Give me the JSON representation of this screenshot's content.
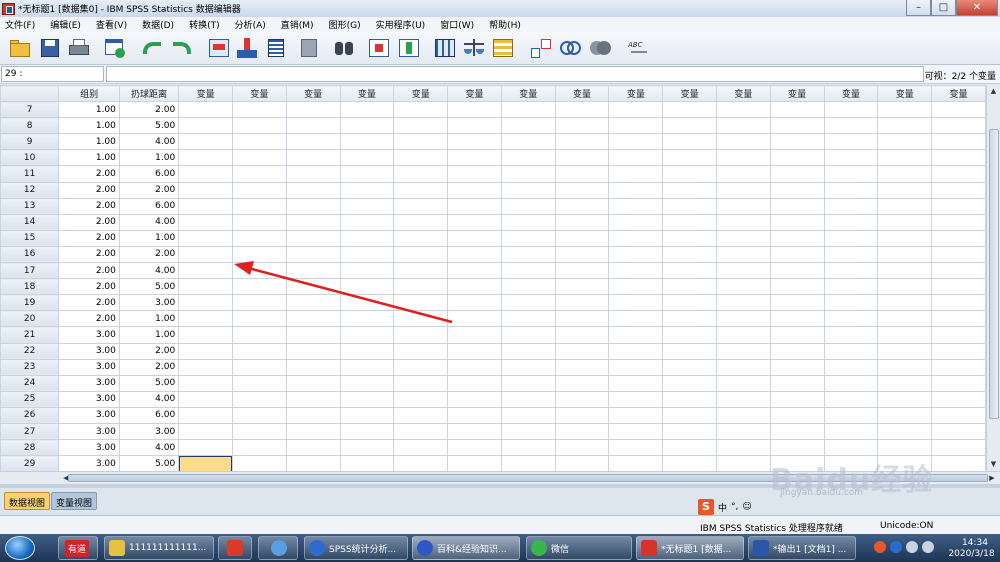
{
  "window": {
    "title": "*无标题1 [数据集0] - IBM SPSS Statistics 数据编辑器",
    "minimize": "–",
    "maximize": "□",
    "close": "✕"
  },
  "menu": [
    "文件(F)",
    "编辑(E)",
    "查看(V)",
    "数据(D)",
    "转换(T)",
    "分析(A)",
    "直销(M)",
    "图形(G)",
    "实用程序(U)",
    "窗口(W)",
    "帮助(H)"
  ],
  "toolbar_icons": [
    "open-icon",
    "save-icon",
    "print-icon",
    "dialog-recall-icon",
    "undo-icon",
    "redo-icon",
    "goto-case-icon",
    "goto-variable-icon",
    "variables-icon",
    "insert-icon",
    "find-icon",
    "insert-cases-icon",
    "insert-variable-icon",
    "split-file-icon",
    "weight-cases-icon",
    "select-cases-icon",
    "value-labels-icon",
    "use-sets-icon",
    "show-all-icon",
    "spell-check-icon"
  ],
  "cell_ref": "29 :",
  "cell_value": "",
  "visible_count": "可视：2/2 个变量",
  "grid": {
    "columns": [
      "组别",
      "扔球距离",
      "变量",
      "变量",
      "变量",
      "变量",
      "变量",
      "变量",
      "变量",
      "变量",
      "变量",
      "变量",
      "变量",
      "变量",
      "变量",
      "变量",
      "变量"
    ],
    "rows": [
      {
        "n": "7",
        "a": "1.00",
        "b": "2.00"
      },
      {
        "n": "8",
        "a": "1.00",
        "b": "5.00"
      },
      {
        "n": "9",
        "a": "1.00",
        "b": "4.00"
      },
      {
        "n": "10",
        "a": "1.00",
        "b": "1.00"
      },
      {
        "n": "11",
        "a": "2.00",
        "b": "6.00"
      },
      {
        "n": "12",
        "a": "2.00",
        "b": "2.00"
      },
      {
        "n": "13",
        "a": "2.00",
        "b": "6.00"
      },
      {
        "n": "14",
        "a": "2.00",
        "b": "4.00"
      },
      {
        "n": "15",
        "a": "2.00",
        "b": "1.00"
      },
      {
        "n": "16",
        "a": "2.00",
        "b": "2.00"
      },
      {
        "n": "17",
        "a": "2.00",
        "b": "4.00"
      },
      {
        "n": "18",
        "a": "2.00",
        "b": "5.00"
      },
      {
        "n": "19",
        "a": "2.00",
        "b": "3.00"
      },
      {
        "n": "20",
        "a": "2.00",
        "b": "1.00"
      },
      {
        "n": "21",
        "a": "3.00",
        "b": "1.00"
      },
      {
        "n": "22",
        "a": "3.00",
        "b": "2.00"
      },
      {
        "n": "23",
        "a": "3.00",
        "b": "2.00"
      },
      {
        "n": "24",
        "a": "3.00",
        "b": "5.00"
      },
      {
        "n": "25",
        "a": "3.00",
        "b": "4.00"
      },
      {
        "n": "26",
        "a": "3.00",
        "b": "6.00"
      },
      {
        "n": "27",
        "a": "3.00",
        "b": "3.00"
      },
      {
        "n": "28",
        "a": "3.00",
        "b": "4.00"
      },
      {
        "n": "29",
        "a": "3.00",
        "b": "5.00"
      }
    ],
    "selected_row": "29",
    "selected_column_index": 3
  },
  "tabs": {
    "data_view": "数据视图",
    "variable_view": "变量视图"
  },
  "status": {
    "processor": "IBM SPSS Statistics 处理程序就绪",
    "encoding": "Unicode:ON"
  },
  "ime": {
    "label": "中"
  },
  "watermark": {
    "brand": "Baidu经验",
    "sub": "jingyan.baidu.com"
  },
  "taskbar": {
    "items": [
      {
        "label": "有道",
        "icon": "youdao-icon"
      },
      {
        "label": "111111111111...",
        "icon": "folder-icon"
      },
      {
        "label": "",
        "icon": "pdf-app-icon"
      },
      {
        "label": "",
        "icon": "app-flower-icon"
      },
      {
        "label": "SPSS统计分析...",
        "icon": "spss-guide-icon"
      },
      {
        "label": "百科&经验知识...",
        "icon": "baidu-icon"
      },
      {
        "label": "微信",
        "icon": "wechat-icon"
      },
      {
        "label": "*无标题1 [数据...",
        "icon": "spss-data-icon"
      },
      {
        "label": "*输出1 [文档1] ...",
        "icon": "spss-output-icon"
      }
    ],
    "time": "14:34",
    "date": "2020/3/18"
  },
  "colors": {
    "selected_cell": "#fedc8c",
    "active_tab": "#fbd174",
    "arrow": "#e02020"
  }
}
